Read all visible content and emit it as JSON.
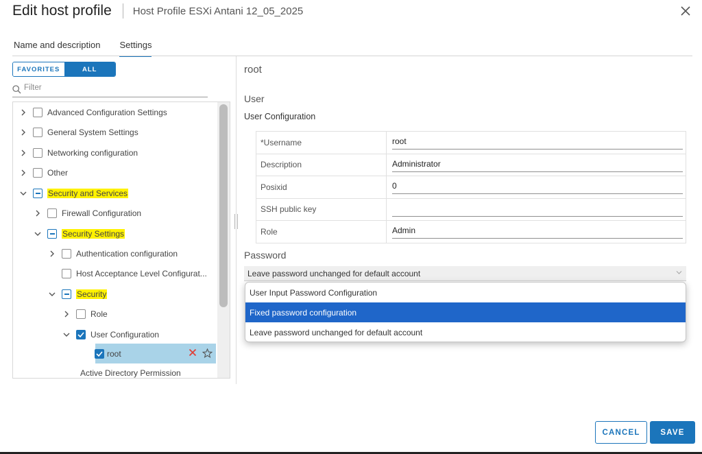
{
  "dialog": {
    "title": "Edit host profile",
    "subtitle": "Host Profile ESXi Antani 12_05_2025"
  },
  "tabs": [
    {
      "label": "Name and description",
      "active": false
    },
    {
      "label": "Settings",
      "active": true
    }
  ],
  "view_toggle": {
    "favorites": "FAVORITES",
    "all": "ALL",
    "selected": "ALL"
  },
  "filter": {
    "placeholder": "Filter",
    "value": ""
  },
  "tree": [
    {
      "label": "Advanced Configuration Settings",
      "level": 0,
      "expandable": true,
      "expanded": false,
      "check": "unchecked",
      "highlighted": false
    },
    {
      "label": "General System Settings",
      "level": 0,
      "expandable": true,
      "expanded": false,
      "check": "unchecked",
      "highlighted": false
    },
    {
      "label": "Networking configuration",
      "level": 0,
      "expandable": true,
      "expanded": false,
      "check": "unchecked",
      "highlighted": false
    },
    {
      "label": "Other",
      "level": 0,
      "expandable": true,
      "expanded": false,
      "check": "unchecked",
      "highlighted": false
    },
    {
      "label": "Security and Services",
      "level": 0,
      "expandable": true,
      "expanded": true,
      "check": "partial",
      "highlighted": true
    },
    {
      "label": "Firewall Configuration",
      "level": 1,
      "expandable": true,
      "expanded": false,
      "check": "unchecked",
      "highlighted": false
    },
    {
      "label": "Security Settings",
      "level": 1,
      "expandable": true,
      "expanded": true,
      "check": "partial",
      "highlighted": true
    },
    {
      "label": "Authentication configuration",
      "level": 2,
      "expandable": true,
      "expanded": false,
      "check": "unchecked",
      "highlighted": false
    },
    {
      "label": "Host Acceptance Level Configurat...",
      "level": 2,
      "expandable": false,
      "expanded": false,
      "check": "unchecked",
      "highlighted": false
    },
    {
      "label": "Security",
      "level": 2,
      "expandable": true,
      "expanded": true,
      "check": "partial",
      "highlighted": true
    },
    {
      "label": "Role",
      "level": 3,
      "expandable": true,
      "expanded": false,
      "check": "unchecked",
      "highlighted": false
    },
    {
      "label": "User Configuration",
      "level": 3,
      "expandable": true,
      "expanded": true,
      "check": "checked",
      "highlighted": false
    },
    {
      "label": "root",
      "level": 4,
      "expandable": false,
      "expanded": false,
      "check": "checked",
      "highlighted": false,
      "selected": true
    },
    {
      "label": "Active Directory Permission",
      "level": 4,
      "expandable": false,
      "expanded": false,
      "check": "none",
      "highlighted": false
    }
  ],
  "detail": {
    "title": "root",
    "section": "User",
    "subsection": "User Configuration",
    "fields": [
      {
        "label": "*Username",
        "value": "root"
      },
      {
        "label": "Description",
        "value": "Administrator"
      },
      {
        "label": "Posixid",
        "value": "0"
      },
      {
        "label": "SSH public key",
        "value": ""
      },
      {
        "label": "Role",
        "value": "Admin"
      }
    ],
    "password": {
      "label": "Password",
      "selected": "Leave password unchanged for default account",
      "options": [
        {
          "label": "User Input Password Configuration",
          "active": false
        },
        {
          "label": "Fixed password configuration",
          "active": true
        },
        {
          "label": "Leave password unchanged for default account",
          "active": false
        }
      ]
    }
  },
  "footer": {
    "cancel": "CANCEL",
    "save": "SAVE"
  },
  "colors": {
    "accent": "#1b75bb",
    "highlight": "#fff200",
    "selected_row": "#a9d3e8",
    "dropdown_active": "#1f66c9"
  }
}
